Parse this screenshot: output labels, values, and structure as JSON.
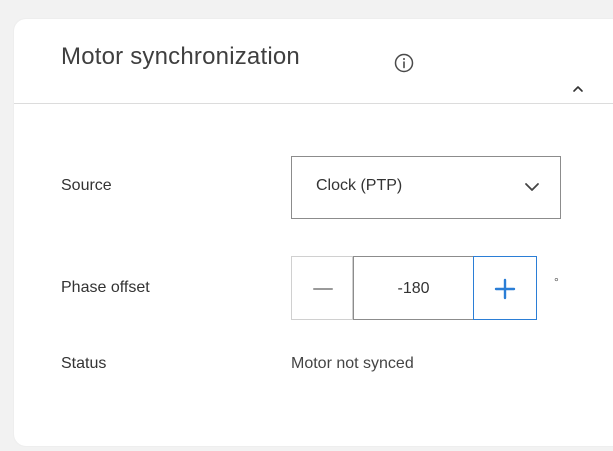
{
  "panel": {
    "title": "Motor synchronization",
    "info_icon": "info-circle-icon",
    "collapse_icon": "chevron-up-icon"
  },
  "source": {
    "label": "Source",
    "selected": "Clock (PTP)",
    "dropdown_icon": "chevron-down-icon"
  },
  "phase_offset": {
    "label": "Phase offset",
    "value": "-180",
    "unit": "°",
    "decrement_icon": "minus-icon",
    "increment_icon": "plus-icon"
  },
  "status": {
    "label": "Status",
    "value": "Motor not synced"
  },
  "colors": {
    "accent": "#2b7ed6",
    "text": "#333333",
    "border": "#8c8c8c",
    "background": "#f2f2f2"
  }
}
